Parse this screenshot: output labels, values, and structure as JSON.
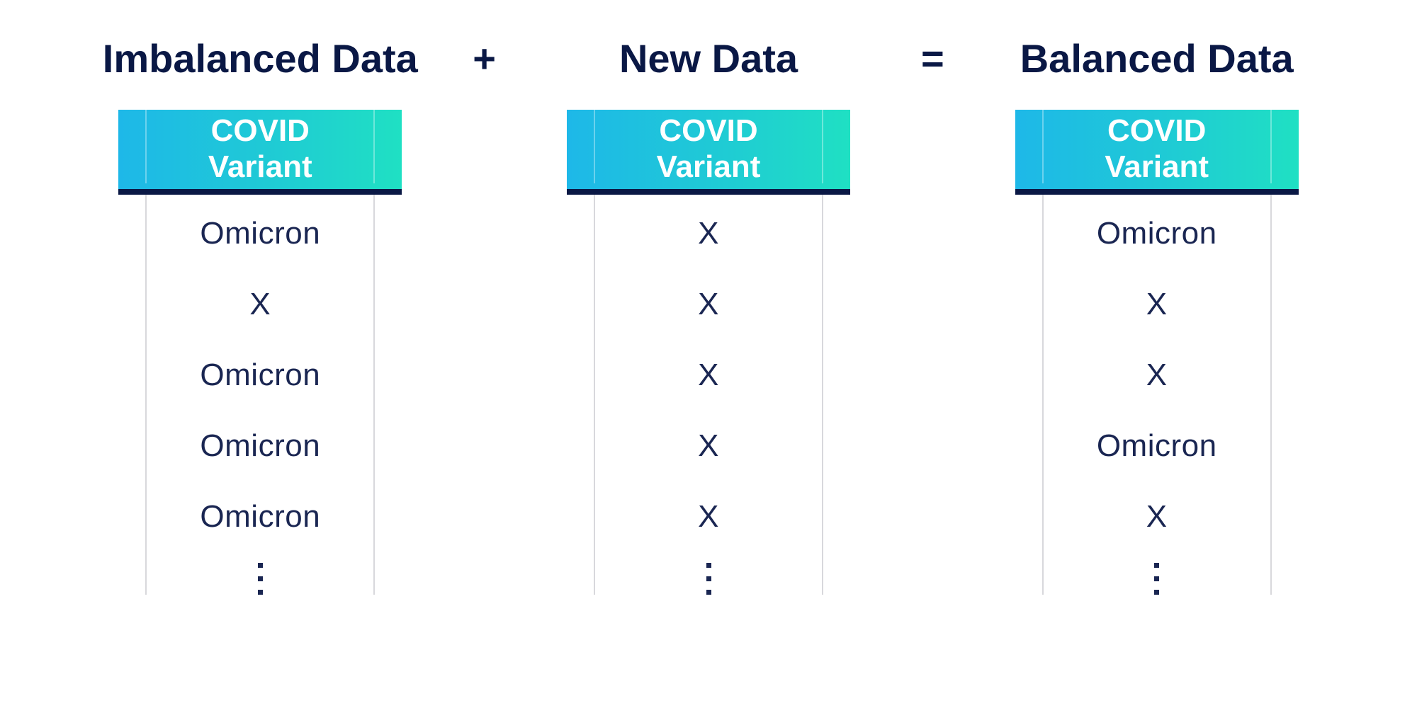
{
  "operators": {
    "plus": "+",
    "equals": "="
  },
  "columns": [
    {
      "title": "Imbalanced Data",
      "header": "COVID\nVariant",
      "rows": [
        "Omicron",
        "X",
        "Omicron",
        "Omicron",
        "Omicron"
      ]
    },
    {
      "title": "New Data",
      "header": "COVID\nVariant",
      "rows": [
        "X",
        "X",
        "X",
        "X",
        "X"
      ]
    },
    {
      "title": "Balanced Data",
      "header": "COVID\nVariant",
      "rows": [
        "Omicron",
        "X",
        "X",
        "Omicron",
        "X"
      ]
    }
  ]
}
